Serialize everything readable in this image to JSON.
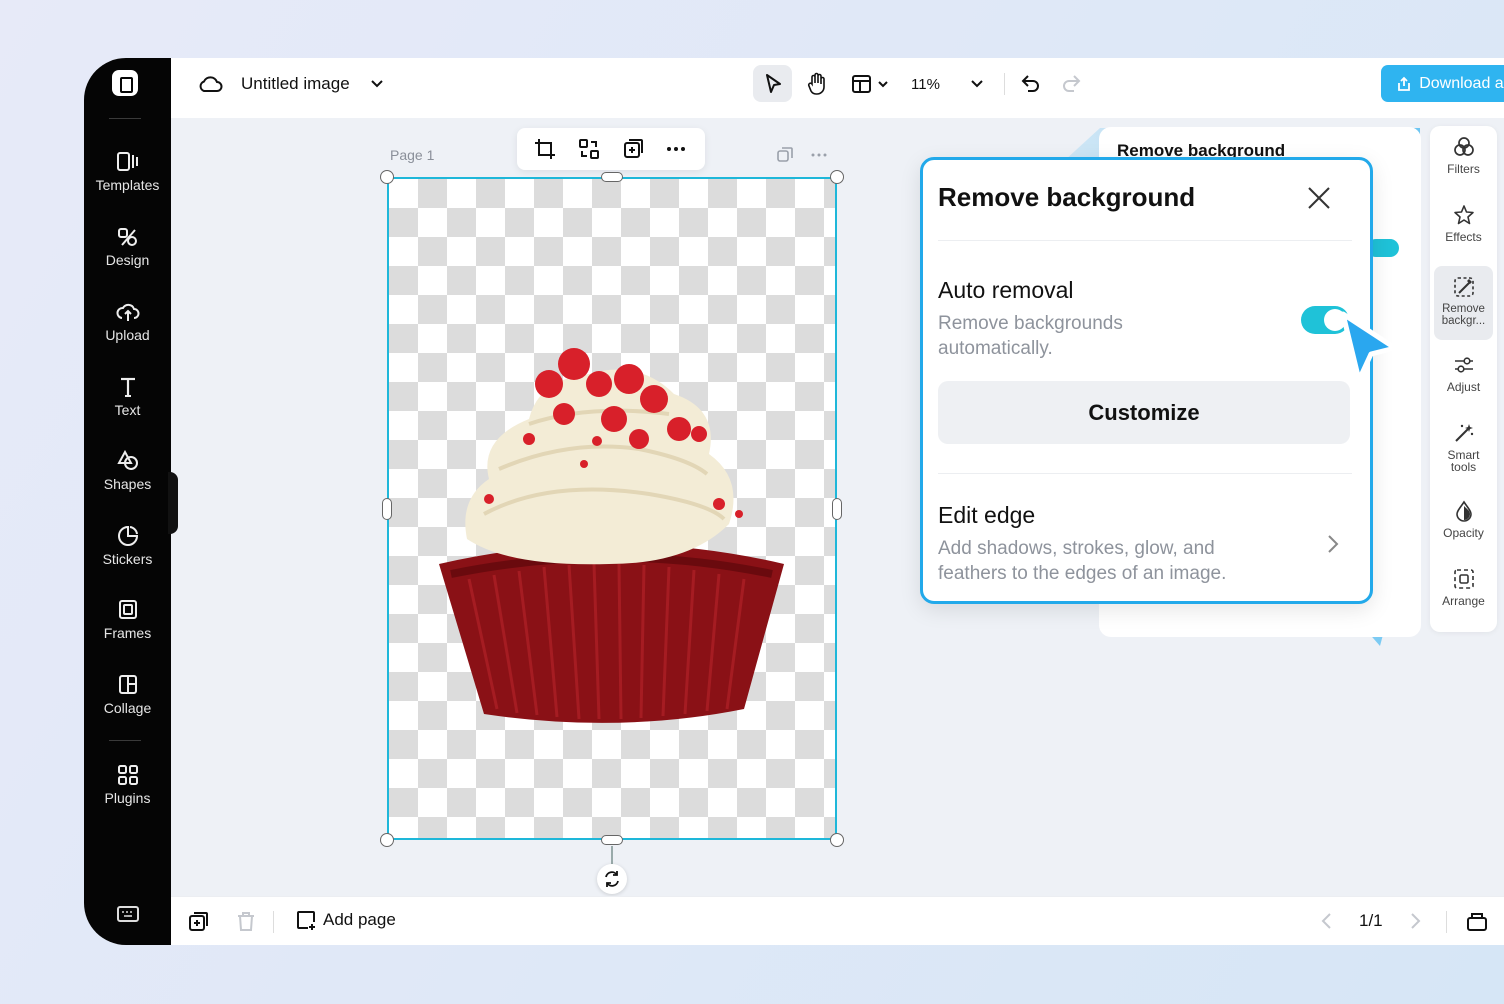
{
  "app": {
    "title": "Untitled image",
    "zoom_level": "11%",
    "download_label": "Download all",
    "accent_color": "#2fb4f0",
    "selection_color": "#1eb7d9"
  },
  "sidebar": {
    "items": [
      {
        "label": "Templates",
        "icon": "templates-icon"
      },
      {
        "label": "Design",
        "icon": "design-icon"
      },
      {
        "label": "Upload",
        "icon": "upload-icon"
      },
      {
        "label": "Text",
        "icon": "text-icon"
      },
      {
        "label": "Shapes",
        "icon": "shapes-icon"
      },
      {
        "label": "Stickers",
        "icon": "stickers-icon"
      },
      {
        "label": "Frames",
        "icon": "frames-icon"
      },
      {
        "label": "Collage",
        "icon": "collage-icon"
      },
      {
        "label": "Plugins",
        "icon": "plugins-icon"
      }
    ]
  },
  "canvas": {
    "page_label": "Page 1"
  },
  "right_tools": [
    {
      "label": "Filters",
      "icon": "filters-icon"
    },
    {
      "label": "Effects",
      "icon": "effects-icon"
    },
    {
      "label": "Remove backgr...",
      "icon": "remove-background-icon",
      "active": true
    },
    {
      "label": "Adjust",
      "icon": "adjust-icon"
    },
    {
      "label": "Smart tools",
      "icon": "smart-tools-icon"
    },
    {
      "label": "Opacity",
      "icon": "opacity-icon"
    },
    {
      "label": "Arrange",
      "icon": "arrange-icon"
    }
  ],
  "panel": {
    "title": "Remove background",
    "auto_removal": {
      "heading": "Auto removal",
      "description": "Remove backgrounds automatically.",
      "enabled": true
    },
    "customize_label": "Customize",
    "edit_edge": {
      "heading": "Edit edge",
      "description": "Add shadows, strokes, glow, and feathers to the edges of an image."
    }
  },
  "bottombar": {
    "add_page_label": "Add page",
    "page_indicator": "1/1"
  }
}
